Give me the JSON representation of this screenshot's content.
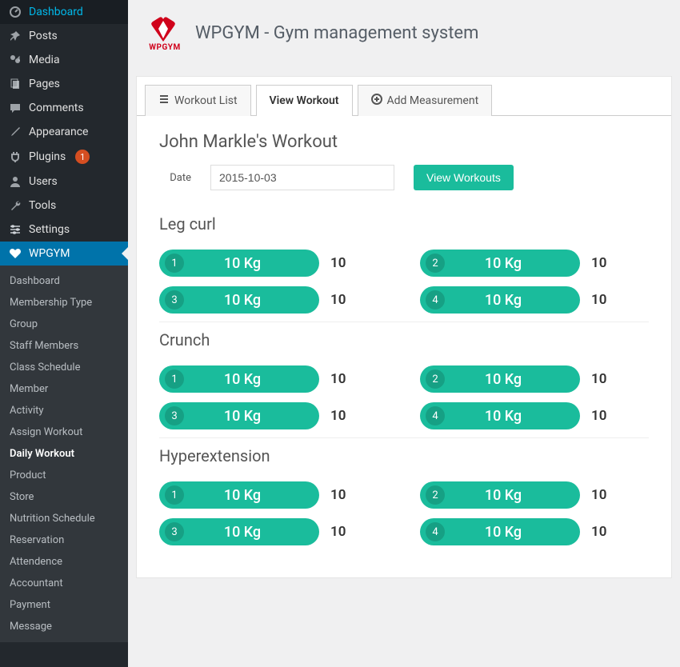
{
  "brand": {
    "name": "WPGYM"
  },
  "header": {
    "title": "WPGYM - Gym management system"
  },
  "sidebar": {
    "top": [
      {
        "icon": "dashboard",
        "label": "Dashboard"
      },
      {
        "icon": "pin",
        "label": "Posts"
      },
      {
        "icon": "media",
        "label": "Media"
      },
      {
        "icon": "pages",
        "label": "Pages"
      },
      {
        "icon": "comments",
        "label": "Comments"
      },
      {
        "icon": "brush",
        "label": "Appearance"
      },
      {
        "icon": "plug",
        "label": "Plugins",
        "badge": "1"
      },
      {
        "icon": "user",
        "label": "Users"
      },
      {
        "icon": "wrench",
        "label": "Tools"
      },
      {
        "icon": "sliders",
        "label": "Settings"
      },
      {
        "icon": "heart",
        "label": "WPGYM",
        "active": true
      }
    ],
    "sub": [
      "Dashboard",
      "Membership Type",
      "Group",
      "Staff Members",
      "Class Schedule",
      "Member",
      "Activity",
      "Assign Workout",
      "Daily Workout",
      "Product",
      "Store",
      "Nutrition Schedule",
      "Reservation",
      "Attendence",
      "Accountant",
      "Payment",
      "Message"
    ],
    "sub_current_index": 8
  },
  "tabs": [
    {
      "icon": "list",
      "label": "Workout List"
    },
    {
      "icon": "",
      "label": "View Workout",
      "active": true
    },
    {
      "icon": "plus",
      "label": "Add Measurement"
    }
  ],
  "workout": {
    "title": "John Markle's Workout",
    "date_label": "Date",
    "date_value": "2015-10-03",
    "view_button": "View Workouts",
    "exercises": [
      {
        "name": "Leg curl",
        "sets": [
          {
            "n": "1",
            "weight": "10 Kg",
            "reps": "10"
          },
          {
            "n": "2",
            "weight": "10 Kg",
            "reps": "10"
          },
          {
            "n": "3",
            "weight": "10 Kg",
            "reps": "10"
          },
          {
            "n": "4",
            "weight": "10 Kg",
            "reps": "10"
          }
        ]
      },
      {
        "name": "Crunch",
        "sets": [
          {
            "n": "1",
            "weight": "10 Kg",
            "reps": "10"
          },
          {
            "n": "2",
            "weight": "10 Kg",
            "reps": "10"
          },
          {
            "n": "3",
            "weight": "10 Kg",
            "reps": "10"
          },
          {
            "n": "4",
            "weight": "10 Kg",
            "reps": "10"
          }
        ]
      },
      {
        "name": "Hyperextension",
        "sets": [
          {
            "n": "1",
            "weight": "10 Kg",
            "reps": "10"
          },
          {
            "n": "2",
            "weight": "10 Kg",
            "reps": "10"
          },
          {
            "n": "3",
            "weight": "10 Kg",
            "reps": "10"
          },
          {
            "n": "4",
            "weight": "10 Kg",
            "reps": "10"
          }
        ]
      }
    ]
  },
  "colors": {
    "accent": "#1abc9c",
    "brand": "#d0021b",
    "wp_blue": "#0073aa"
  }
}
